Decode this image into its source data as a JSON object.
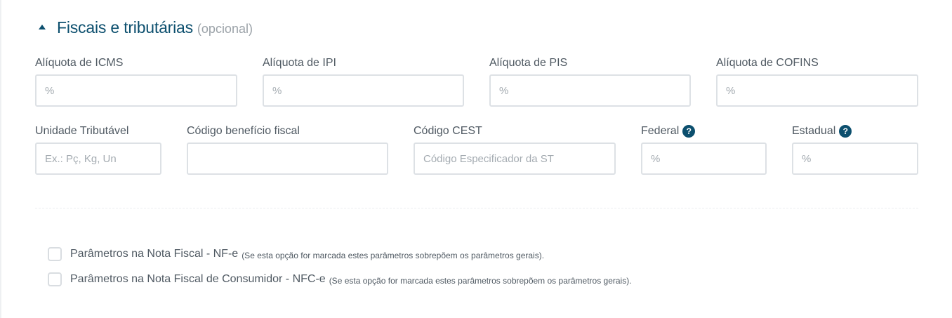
{
  "section": {
    "title": "Fiscais e tributárias",
    "optional": "(opcional)"
  },
  "row1": [
    {
      "label": "Alíquota de ICMS",
      "placeholder": "%",
      "value": ""
    },
    {
      "label": "Alíquota de IPI",
      "placeholder": "%",
      "value": ""
    },
    {
      "label": "Alíquota de PIS",
      "placeholder": "%",
      "value": ""
    },
    {
      "label": "Alíquota de COFINS",
      "placeholder": "%",
      "value": ""
    }
  ],
  "row2": [
    {
      "label": "Unidade Tributável",
      "placeholder": "Ex.: Pç, Kg, Un",
      "value": ""
    },
    {
      "label": "Código benefício fiscal",
      "placeholder": "",
      "value": ""
    },
    {
      "label": "Código CEST",
      "placeholder": "Código Especificador da ST",
      "value": ""
    },
    {
      "label": "Federal",
      "placeholder": "%",
      "value": "",
      "help_icon": "question-circle-icon"
    },
    {
      "label": "Estadual",
      "placeholder": "%",
      "value": "",
      "help_icon": "question-circle-icon"
    }
  ],
  "help_icon_glyph": "?",
  "checkboxes": [
    {
      "label": "Parâmetros na Nota Fiscal - NF-e",
      "note": "(Se esta opção for marcada estes parâmetros sobrepõem os parâmetros gerais).",
      "checked": false
    },
    {
      "label": "Parâmetros na Nota Fiscal de Consumidor - NFC-e",
      "note": "(Se esta opção for marcada estes parâmetros sobrepõem os parâmetros gerais).",
      "checked": false
    }
  ],
  "colors": {
    "accent": "#0c4f6e",
    "border": "#dde1e5",
    "text": "#4f5962",
    "muted": "#9ba2a8"
  }
}
